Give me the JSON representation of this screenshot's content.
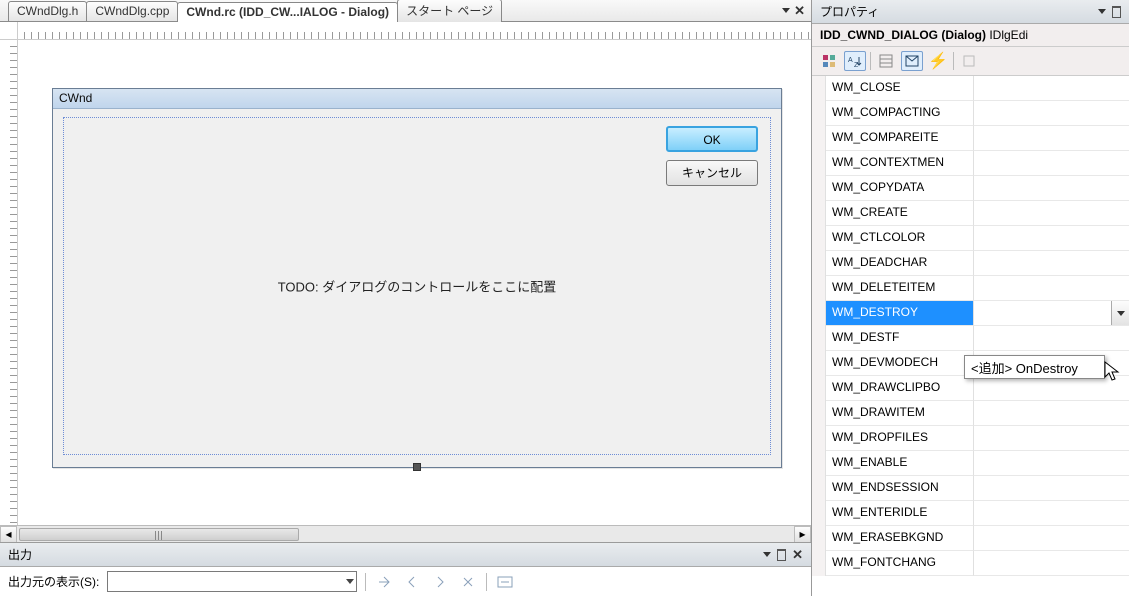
{
  "tabs": [
    {
      "label": "CWndDlg.h"
    },
    {
      "label": "CWndDlg.cpp"
    },
    {
      "label": "CWnd.rc (IDD_CW...IALOG - Dialog)"
    },
    {
      "label": "スタート ページ"
    }
  ],
  "active_tab_index": 2,
  "dialog": {
    "title": "CWnd",
    "ok_label": "OK",
    "cancel_label": "キャンセル",
    "todo_text": "TODO: ダイアログのコントロールをここに配置"
  },
  "output": {
    "panel_title": "出力",
    "source_label": "出力元の表示(S):"
  },
  "properties": {
    "panel_title": "プロパティ",
    "subject": "IDD_CWND_DIALOG (Dialog)",
    "subject_suffix": "IDlgEdi",
    "selected_index": 9,
    "messages": [
      "WM_CLOSE",
      "WM_COMPACTING",
      "WM_COMPAREITE",
      "WM_CONTEXTMEN",
      "WM_COPYDATA",
      "WM_CREATE",
      "WM_CTLCOLOR",
      "WM_DEADCHAR",
      "WM_DELETEITEM",
      "WM_DESTROY",
      "WM_DESTF",
      "WM_DEVMODECH",
      "WM_DRAWCLIPBO",
      "WM_DRAWITEM",
      "WM_DROPFILES",
      "WM_ENABLE",
      "WM_ENDSESSION",
      "WM_ENTERIDLE",
      "WM_ERASEBKGND",
      "WM_FONTCHANG"
    ],
    "dropdown_option": "<追加> OnDestroy"
  }
}
